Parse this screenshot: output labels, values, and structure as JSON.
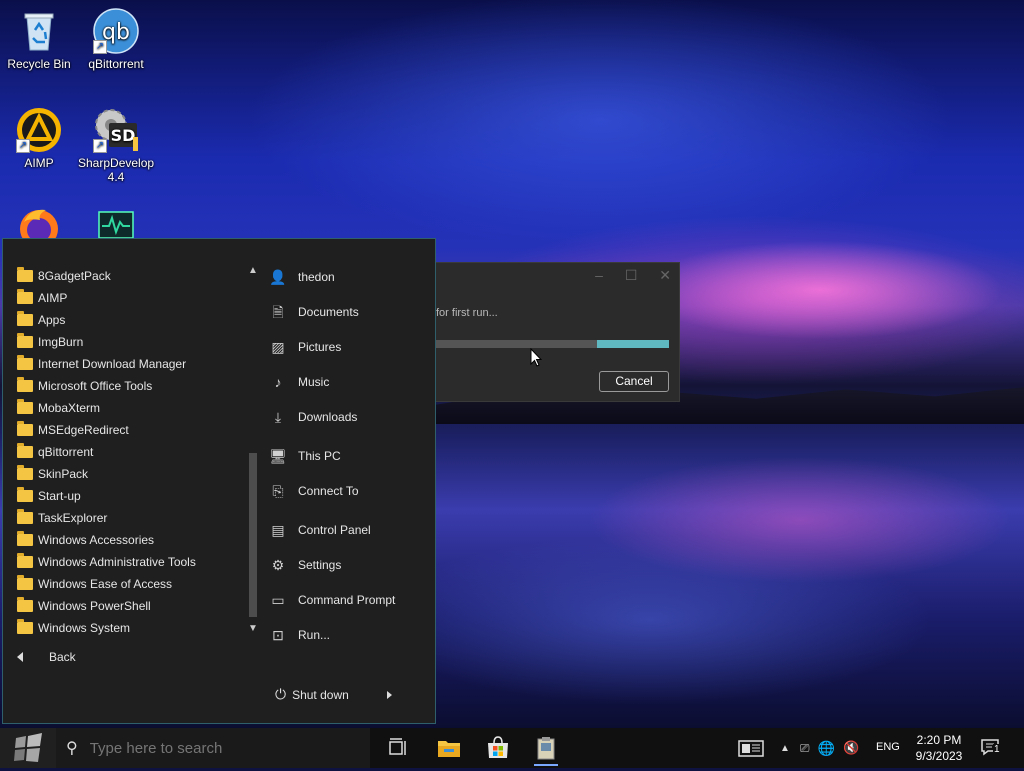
{
  "desktop": {
    "icons": [
      {
        "label": "Recycle Bin",
        "icon": "recycle-bin-icon"
      },
      {
        "label": "qBittorrent",
        "icon": "qbittorrent-icon"
      },
      {
        "label": "AIMP",
        "icon": "aimp-icon"
      },
      {
        "label": "SharpDevelop 4.4",
        "icon": "sharpdevelop-icon"
      },
      {
        "label": "",
        "icon": "firefox-icon"
      },
      {
        "label": "",
        "icon": "monitor-icon"
      }
    ]
  },
  "dialog": {
    "message": "for first run...",
    "cancel_label": "Cancel",
    "progress": 0.31,
    "colors": {
      "fill": "#5fb8c0",
      "track": "#555555"
    }
  },
  "start_menu": {
    "apps": [
      {
        "label": "8GadgetPack"
      },
      {
        "label": "AIMP"
      },
      {
        "label": "Apps"
      },
      {
        "label": "ImgBurn"
      },
      {
        "label": "Internet Download Manager"
      },
      {
        "label": "Microsoft Office Tools"
      },
      {
        "label": "MobaXterm"
      },
      {
        "label": "MSEdgeRedirect"
      },
      {
        "label": "qBittorrent"
      },
      {
        "label": "SkinPack"
      },
      {
        "label": "Start-up"
      },
      {
        "label": "TaskExplorer"
      },
      {
        "label": "Windows Accessories"
      },
      {
        "label": "Windows Administrative Tools"
      },
      {
        "label": "Windows Ease of Access"
      },
      {
        "label": "Windows PowerShell"
      },
      {
        "label": "Windows System"
      }
    ],
    "back_label": "Back",
    "places": [
      {
        "label": "thedon",
        "icon": "user-folder-icon"
      },
      {
        "label": "Documents",
        "icon": "documents-icon"
      },
      {
        "label": "Pictures",
        "icon": "pictures-icon"
      },
      {
        "label": "Music",
        "icon": "music-icon"
      },
      {
        "label": "Downloads",
        "icon": "downloads-icon"
      },
      {
        "label": "This PC",
        "icon": "this-pc-icon"
      },
      {
        "label": "Connect To",
        "icon": "connect-to-icon"
      },
      {
        "label": "Control Panel",
        "icon": "control-panel-icon"
      },
      {
        "label": "Settings",
        "icon": "gear-icon"
      },
      {
        "label": "Command Prompt",
        "icon": "command-prompt-icon"
      },
      {
        "label": "Run...",
        "icon": "run-icon"
      }
    ],
    "shutdown_label": "Shut down"
  },
  "taskbar": {
    "search_placeholder": "Type here to search",
    "language": "ENG",
    "time": "2:20 PM",
    "date": "9/3/2023",
    "notification_count": "1"
  }
}
